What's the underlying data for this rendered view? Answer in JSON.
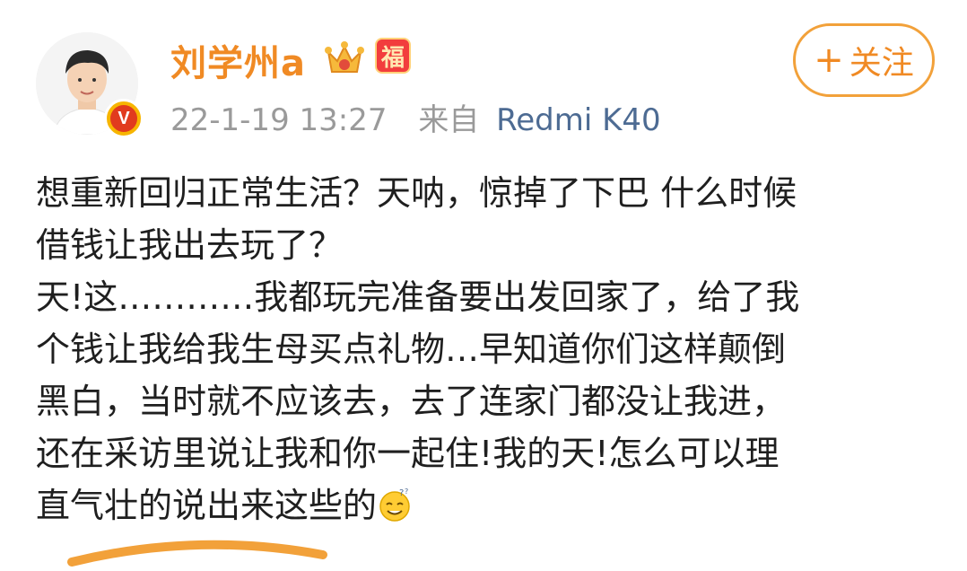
{
  "post": {
    "author": {
      "name": "刘学州a",
      "verified_badge": "V",
      "fortune_badge": "福"
    },
    "meta": {
      "timestamp": "22-1-19 13:27",
      "source_prefix": "来自",
      "device": "Redmi K40"
    },
    "follow_button": {
      "plus": "+",
      "label": "关注"
    },
    "lines": [
      "想重新回归正常生活？天呐，惊掉了下巴 什么时候",
      "借钱让我出去玩了？",
      "天!这…………我都玩完准备要出发回家了，给了我",
      "个钱让我给我生母买点礼物…早知道你们这样颠倒",
      "黑白，当时就不应该去，去了连家门都没让我进，",
      "还在采访里说让我和你一起住!我的天!怎么可以理",
      "直气壮的说出来这些的"
    ],
    "trailing_emoji": "thinking-smile-emoji"
  },
  "colors": {
    "username": "#f08a24",
    "follow_border": "#f2a13a",
    "meta_gray": "#9a9a9a",
    "device_link": "#4d6b93",
    "body_text": "#1f1f1f"
  }
}
